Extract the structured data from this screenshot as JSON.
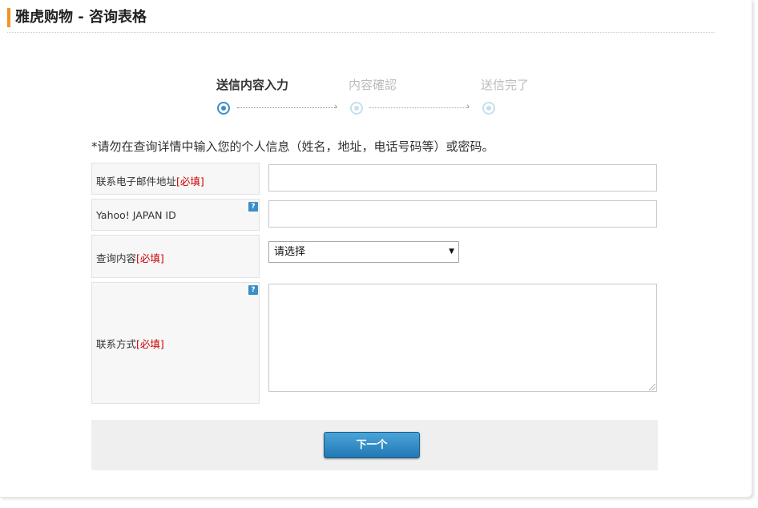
{
  "page": {
    "title": "雅虎购物 - 咨询表格"
  },
  "steps": [
    {
      "label": "送信内容入力",
      "state": "active"
    },
    {
      "label": "内容確認",
      "state": "inactive"
    },
    {
      "label": "送信完了",
      "state": "inactive"
    }
  ],
  "notice": "*请勿在查询详情中输入您的个人信息（姓名，地址，电话号码等）或密码。",
  "form": {
    "email": {
      "label": "联系电子邮件地址",
      "required": "[必填]",
      "value": ""
    },
    "yahoo_id": {
      "label": "Yahoo! JAPAN ID",
      "help": "?",
      "value": ""
    },
    "inquiry": {
      "label": "查询内容",
      "required": "[必填]",
      "selected": "请选择"
    },
    "contact": {
      "label": "联系方式",
      "required": "[必填]",
      "help": "?",
      "value": ""
    }
  },
  "actions": {
    "next_label": "下一个"
  },
  "colors": {
    "accent": "#f19422",
    "primary": "#2277b3",
    "required": "#cc0000"
  }
}
